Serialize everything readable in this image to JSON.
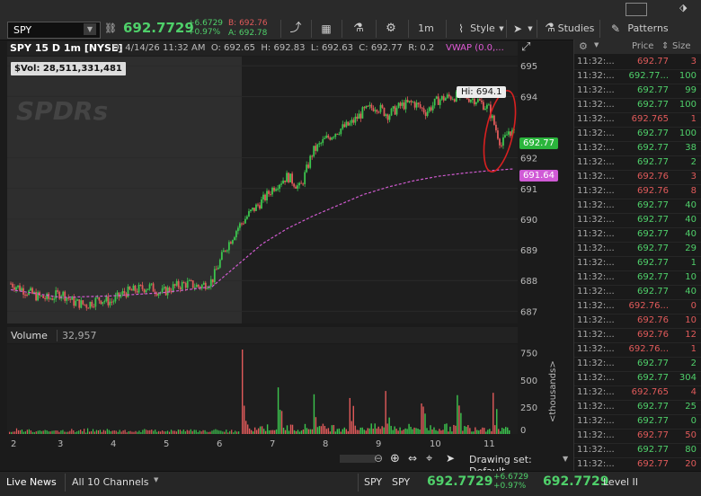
{
  "toolbar": {
    "symbol": "SPY",
    "last": "692.7729",
    "net_change": "+6.6729",
    "net_pct": "+0.97%",
    "bid": "B: 692.76",
    "ask": "A: 692.78",
    "timeframe": "1m",
    "style_label": "Style",
    "studies_label": "Studies",
    "patterns_label": "Patterns"
  },
  "chart": {
    "title": "SPY 15 D 1m [NYSE]",
    "date": "D: 4/14/26 11:32 AM",
    "open": "O: 692.65",
    "high": "H: 692.83",
    "low": "L: 692.63",
    "close": "C: 692.77",
    "range": "R: 0.2",
    "vwap": "VWAP (0.0,...",
    "svol": "$Vol: 28,511,331,481",
    "watermark": "SPDRs",
    "hi_label": "Hi: 694.1",
    "last_label": "692.77",
    "vwap_label": "691.64"
  },
  "volume_head": {
    "label": "Volume",
    "value": "32,957"
  },
  "volume_axis_unit": "<thousands>",
  "drawing_set": "Drawing set: Default",
  "bottom": {
    "live_news": "Live News",
    "channels": "All 10 Channels",
    "sym1": "SPY",
    "sym2": "SPY",
    "last": "692.7729",
    "net": "+6.6729",
    "pct": "+0.97%",
    "last2": "692.7729",
    "level2": "Level II"
  },
  "ts": {
    "headers": [
      "Price",
      "Size"
    ],
    "rows": [
      {
        "t": "11:32:...",
        "p": "692.77",
        "s": "3",
        "d": "dn"
      },
      {
        "t": "11:32:...",
        "p": "692.77...",
        "s": "100",
        "d": "up"
      },
      {
        "t": "11:32:...",
        "p": "692.77",
        "s": "99",
        "d": "up"
      },
      {
        "t": "11:32:...",
        "p": "692.77",
        "s": "100",
        "d": "up"
      },
      {
        "t": "11:32:...",
        "p": "692.765",
        "s": "1",
        "d": "dn"
      },
      {
        "t": "11:32:...",
        "p": "692.77",
        "s": "100",
        "d": "up"
      },
      {
        "t": "11:32:...",
        "p": "692.77",
        "s": "38",
        "d": "up"
      },
      {
        "t": "11:32:...",
        "p": "692.77",
        "s": "2",
        "d": "up"
      },
      {
        "t": "11:32:...",
        "p": "692.76",
        "s": "3",
        "d": "dn"
      },
      {
        "t": "11:32:...",
        "p": "692.76",
        "s": "8",
        "d": "dn"
      },
      {
        "t": "11:32:...",
        "p": "692.77",
        "s": "40",
        "d": "up"
      },
      {
        "t": "11:32:...",
        "p": "692.77",
        "s": "40",
        "d": "up"
      },
      {
        "t": "11:32:...",
        "p": "692.77",
        "s": "40",
        "d": "up"
      },
      {
        "t": "11:32:...",
        "p": "692.77",
        "s": "29",
        "d": "up"
      },
      {
        "t": "11:32:...",
        "p": "692.77",
        "s": "1",
        "d": "up"
      },
      {
        "t": "11:32:...",
        "p": "692.77",
        "s": "10",
        "d": "up"
      },
      {
        "t": "11:32:...",
        "p": "692.77",
        "s": "40",
        "d": "up"
      },
      {
        "t": "11:32:...",
        "p": "692.76...",
        "s": "0",
        "d": "dn"
      },
      {
        "t": "11:32:...",
        "p": "692.76",
        "s": "10",
        "d": "dn"
      },
      {
        "t": "11:32:...",
        "p": "692.76",
        "s": "12",
        "d": "dn"
      },
      {
        "t": "11:32:...",
        "p": "692.76...",
        "s": "1",
        "d": "dn"
      },
      {
        "t": "11:32:...",
        "p": "692.77",
        "s": "2",
        "d": "up"
      },
      {
        "t": "11:32:...",
        "p": "692.77",
        "s": "304",
        "d": "up"
      },
      {
        "t": "11:32:...",
        "p": "692.765",
        "s": "4",
        "d": "dn"
      },
      {
        "t": "11:32:...",
        "p": "692.77",
        "s": "25",
        "d": "up"
      },
      {
        "t": "11:32:...",
        "p": "692.77",
        "s": "0",
        "d": "up"
      },
      {
        "t": "11:32:...",
        "p": "692.77",
        "s": "50",
        "d": "dn"
      },
      {
        "t": "11:32:...",
        "p": "692.77",
        "s": "80",
        "d": "up"
      },
      {
        "t": "11:32:...",
        "p": "692.77",
        "s": "20",
        "d": "dn"
      }
    ]
  },
  "chart_data": {
    "type": "candlestick",
    "price_ticks": [
      "695",
      "694",
      "692",
      "691",
      "690",
      "689",
      "688",
      "687"
    ],
    "price_tick_values": [
      695,
      694,
      692,
      691,
      690,
      689,
      688,
      687
    ],
    "ylim": [
      686.6,
      695.3
    ],
    "volume_ticks": [
      "750",
      "500",
      "250",
      "0"
    ],
    "volume_tick_values": [
      750,
      500,
      250,
      0
    ],
    "volume_ylim": [
      0,
      830
    ],
    "day_ticks": [
      "2",
      "3",
      "4",
      "5",
      "6",
      "7",
      "8",
      "9",
      "10",
      "11"
    ],
    "price_path": [
      [
        0,
        687.9
      ],
      [
        0.5,
        687.7
      ],
      [
        1,
        687.5
      ],
      [
        1.5,
        687.4
      ],
      [
        2,
        687.6
      ],
      [
        2.5,
        687.3
      ],
      [
        3,
        687.2
      ],
      [
        3.5,
        687.4
      ],
      [
        4,
        687.3
      ],
      [
        4.5,
        687.6
      ],
      [
        5,
        687.7
      ],
      [
        5.5,
        687.8
      ],
      [
        6,
        687.6
      ],
      [
        6.5,
        687.8
      ],
      [
        7,
        687.9
      ],
      [
        7.5,
        687.8
      ],
      [
        8,
        688.0
      ],
      [
        8.5,
        689.0
      ],
      [
        9,
        689.7
      ],
      [
        9.5,
        690.2
      ],
      [
        10,
        690.6
      ],
      [
        10.5,
        691.1
      ],
      [
        11,
        691.4
      ],
      [
        11.5,
        691.0
      ],
      [
        12,
        692.2
      ],
      [
        12.5,
        692.6
      ],
      [
        13,
        692.9
      ],
      [
        13.5,
        693.1
      ],
      [
        14,
        693.5
      ],
      [
        14.5,
        693.7
      ],
      [
        15,
        693.4
      ],
      [
        15.5,
        693.7
      ],
      [
        16,
        693.8
      ],
      [
        16.5,
        693.5
      ],
      [
        17,
        693.9
      ],
      [
        17.5,
        694.0
      ],
      [
        18,
        694.0
      ],
      [
        18.5,
        693.9
      ],
      [
        19,
        693.6
      ],
      [
        19.5,
        692.4
      ],
      [
        19.8,
        692.9
      ],
      [
        20,
        692.77
      ]
    ],
    "vwap_path": [
      [
        0,
        687.7
      ],
      [
        2,
        687.45
      ],
      [
        4,
        687.5
      ],
      [
        6,
        687.6
      ],
      [
        8,
        687.8
      ],
      [
        9,
        688.5
      ],
      [
        10,
        689.2
      ],
      [
        11,
        689.7
      ],
      [
        12,
        690.1
      ],
      [
        13,
        690.45
      ],
      [
        14,
        690.8
      ],
      [
        15,
        691.05
      ],
      [
        16,
        691.25
      ],
      [
        17,
        691.4
      ],
      [
        18,
        691.5
      ],
      [
        19,
        691.58
      ],
      [
        20,
        691.64
      ]
    ],
    "volume_bars_pre": [
      30,
      25,
      35,
      20,
      40,
      30,
      25,
      35,
      20,
      30,
      28,
      32,
      26,
      30,
      22,
      35,
      40,
      28,
      30,
      25
    ],
    "volume_bars_reg": [
      780,
      320,
      260,
      240,
      210,
      200,
      220,
      190,
      180,
      170,
      150,
      160,
      140,
      150,
      130,
      120,
      110,
      100,
      90,
      80,
      70,
      60
    ],
    "hi_value": 694.1,
    "last_value": 692.77,
    "vwap_value": 691.64
  }
}
